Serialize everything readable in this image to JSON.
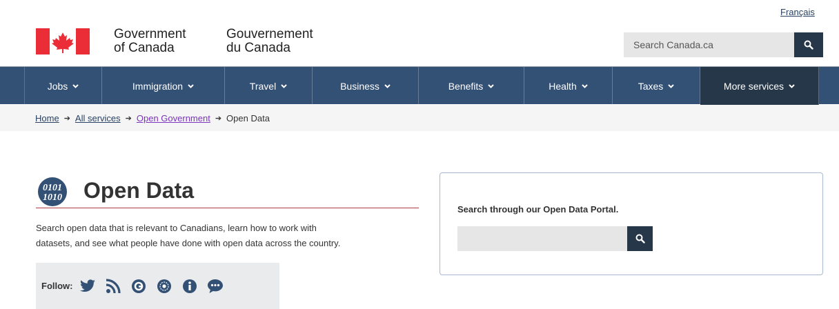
{
  "header": {
    "lang_toggle": "Français",
    "gov_en_line1": "Government",
    "gov_en_line2": "of Canada",
    "gov_fr_line1": "Gouvernement",
    "gov_fr_line2": "du Canada",
    "search_placeholder": "Search Canada.ca",
    "search_icon": "search-icon",
    "flag_icon": "canada-flag-icon",
    "accent_red": "#eb2d37",
    "menu_bg": "#335075",
    "dark_blue": "#26374a"
  },
  "menu": {
    "items": [
      {
        "label": "Jobs"
      },
      {
        "label": "Immigration"
      },
      {
        "label": "Travel"
      },
      {
        "label": "Business"
      },
      {
        "label": "Benefits"
      },
      {
        "label": "Health"
      },
      {
        "label": "Taxes"
      },
      {
        "label": "More services"
      }
    ]
  },
  "breadcrumb": {
    "items": [
      "Home",
      "All services",
      "Open Government"
    ],
    "current": "Open Data"
  },
  "main": {
    "title": "Open Data",
    "title_icon": "open-data-binary-icon",
    "intro_line1": "Search open data that is relevant to Canadians, learn how to work with",
    "intro_line2": "datasets, and see what people have done with open data across the country.",
    "follow_label": "Follow:",
    "social_icons": [
      "twitter-icon",
      "rss-icon",
      "gcpedia-icon",
      "open-gov-icon",
      "info-icon",
      "chat-icon"
    ]
  },
  "portal": {
    "label": "Search through our Open Data Portal.",
    "search_value": "",
    "search_icon": "search-icon"
  }
}
